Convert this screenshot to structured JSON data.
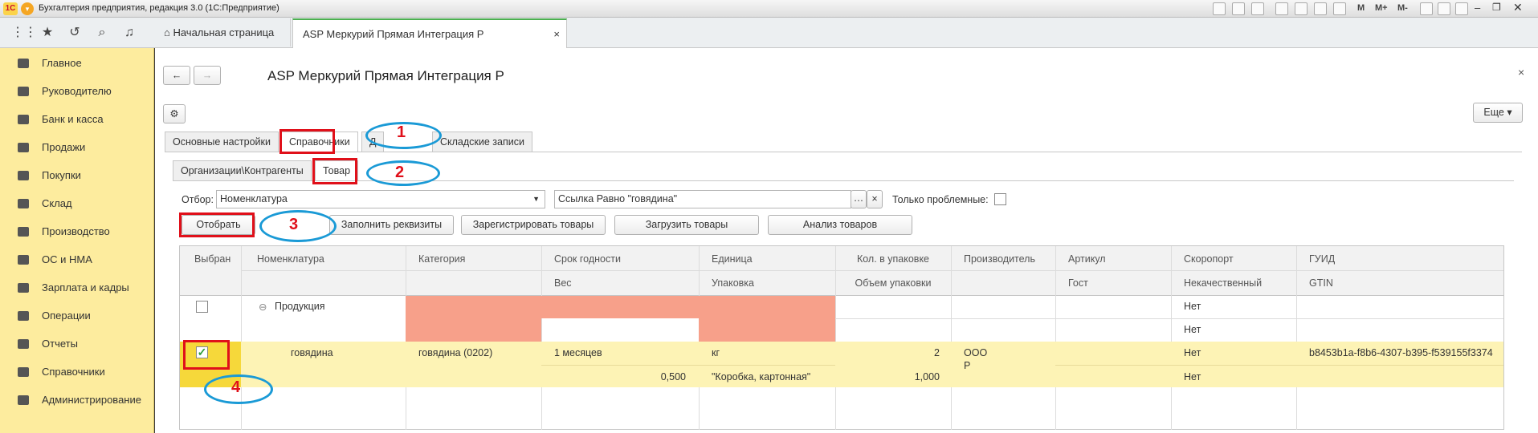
{
  "app": {
    "title": "Бухгалтерия предприятия, редакция 3.0  (1С:Предприятие)",
    "logo": "1С"
  },
  "toolbar_right": [
    "M",
    "M+",
    "M-"
  ],
  "tabs": [
    {
      "label": "Начальная страница",
      "icon": "home-icon"
    },
    {
      "label": "ASP Меркурий Прямая Интеграция Р",
      "close": "×"
    }
  ],
  "sidebar": {
    "items": [
      {
        "label": "Главное",
        "icon": "menu-lines-icon"
      },
      {
        "label": "Руководителю",
        "icon": "chart-line-icon"
      },
      {
        "label": "Банк и касса",
        "icon": "ruble-coin-icon"
      },
      {
        "label": "Продажи",
        "icon": "bag-icon"
      },
      {
        "label": "Покупки",
        "icon": "cart-icon"
      },
      {
        "label": "Склад",
        "icon": "warehouse-icon"
      },
      {
        "label": "Производство",
        "icon": "factory-icon"
      },
      {
        "label": "ОС и НМА",
        "icon": "truck-icon"
      },
      {
        "label": "Зарплата и кадры",
        "icon": "person-icon"
      },
      {
        "label": "Операции",
        "icon": "operations-icon"
      },
      {
        "label": "Отчеты",
        "icon": "bar-chart-icon"
      },
      {
        "label": "Справочники",
        "icon": "books-icon"
      },
      {
        "label": "Администрирование",
        "icon": "gear-icon"
      }
    ]
  },
  "form": {
    "title": "ASP Меркурий Прямая Интеграция Р",
    "more_label": "Еще",
    "close": "×",
    "main_tabs": [
      "Основные настройки",
      "Справочники",
      "Д",
      "Складские записи"
    ],
    "sub_tabs": [
      "Организации\\Контрагенты",
      "Товар"
    ],
    "filter_label": "Отбор:",
    "filter_field": "Номенклатура",
    "filter_value": "Ссылка Равно \"говядина\"",
    "only_problems_label": "Только проблемные:",
    "buttons": [
      "Отобрать",
      "Заполнить реквизиты",
      "Зарегистрировать товары",
      "Загрузить товары",
      "Анализ товаров"
    ]
  },
  "table": {
    "headers_top": [
      "Выбран",
      "Номенклатура",
      "Категория",
      "Срок годности",
      "Единица",
      "Кол. в упаковке",
      "Производитель",
      "Артикул",
      "Скоропорт",
      "ГУИД"
    ],
    "headers_bottom": [
      "Вес",
      "Упаковка",
      "Объем упаковки",
      "Гост",
      "Некачественный",
      "GTIN"
    ],
    "group_row": {
      "name": "Продукция",
      "skoroport": "Нет",
      "nekach": "Нет",
      "expand": "⊖"
    },
    "item_row": {
      "name": "говядина",
      "category": "говядина (0202)",
      "srok": "1 месяцев",
      "unit": "кг",
      "qty": "2",
      "manufacturer_1": "ООО",
      "manufacturer_2": "Р",
      "skoroport": "Нет",
      "guid": "b8453b1a-f8b6-4307-b395-f539155f3374",
      "weight": "0,500",
      "pack": "\"Коробка, картонная\"",
      "volume": "1,000",
      "nekach": "Нет"
    }
  },
  "annotations": [
    "1",
    "2",
    "3",
    "4"
  ],
  "colors": {
    "accent_red": "#e0101a",
    "oval_blue": "#1a9ad6",
    "sidebar": "#fdec9e",
    "row_highlight": "#fdf3b5",
    "error_cell": "#f7a08a"
  }
}
